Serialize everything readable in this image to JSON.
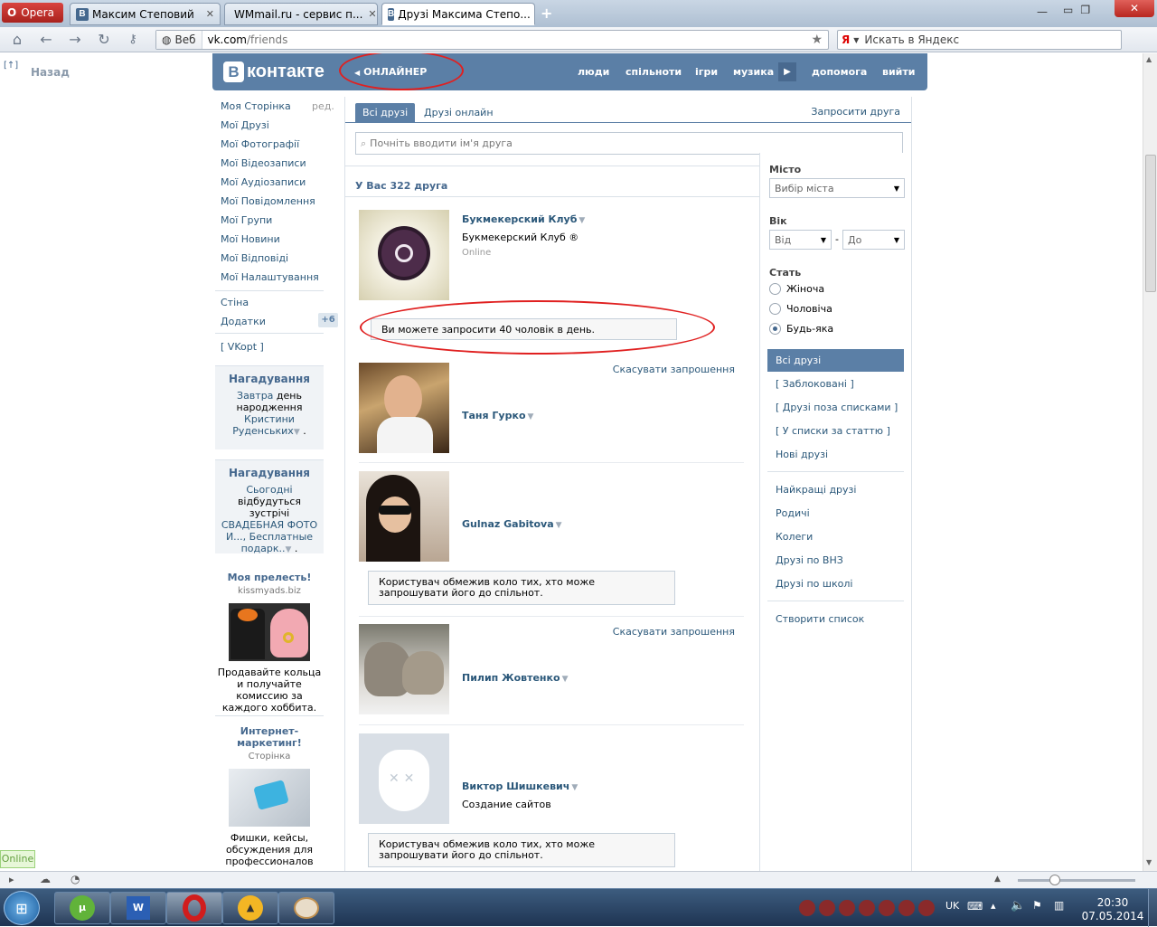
{
  "browser": {
    "opera_label": "Opera",
    "tabs": [
      {
        "title": "Максим Степовий"
      },
      {
        "title": "WMmail.ru - сервис п..."
      },
      {
        "title": "Друзі Максима Степо..."
      }
    ],
    "web_label": "Веб",
    "url_host": "vk.com",
    "url_path": "/friends",
    "search_placeholder": "Искать в Яндекс"
  },
  "page": {
    "back_label": "Назад",
    "header": {
      "logo_text": "контакте",
      "onliner": "ОНЛАЙНЕР",
      "nav": [
        "люди",
        "спільноти",
        "ігри",
        "музика",
        "допомога",
        "вийти"
      ]
    },
    "left_menu": {
      "items": [
        "Моя Сторінка",
        "Мої Друзі",
        "Мої Фотографії",
        "Мої Відеозаписи",
        "Мої Аудіозаписи",
        "Мої Повідомлення",
        "Мої Групи",
        "Мої Новини",
        "Мої Відповіді",
        "Мої Налаштування"
      ],
      "edit_label": "ред.",
      "wall": "Стіна",
      "apps": "Додатки",
      "apps_badge": "+6",
      "vkopt": "[ VKopt ]"
    },
    "reminders": [
      {
        "title": "Нагадування",
        "link1": "Завтра",
        "text1": " день народження",
        "link2": "Кристини Руденських",
        "tail": " ."
      },
      {
        "title": "Нагадування",
        "link1": "Сьогодні",
        "text1": " відбудуться зустрічі",
        "link2": "СВАДЕБНАЯ ФОТО И..., Бесплатные подарк..",
        "tail": " ."
      }
    ],
    "ads": [
      {
        "title": "Моя прелесть!",
        "site": "kissmyads.biz",
        "text": "Продавайте кольца и получайте комиссию за каждого хоббита."
      },
      {
        "title": "Интернет-маркетинг!",
        "site": "Сторінка",
        "text": "Фишки, кейсы, обсуждения для профессионалов"
      }
    ],
    "tabs": {
      "all": "Всі друзі",
      "online": "Друзі онлайн",
      "invite": "Запросити друга"
    },
    "search_placeholder": "Почніть вводити ім'я друга",
    "count_text": "У Вас 322 друга",
    "friends": [
      {
        "name": "Букмекерский Клуб",
        "subtitle": "Букмекерский Клуб ®",
        "status": "Online",
        "action": "",
        "notice": "Ви можете запросити 40 чоловік в день."
      },
      {
        "name": "Таня Гурко",
        "subtitle": "",
        "status": "",
        "action": "Скасувати запрошення",
        "notice": ""
      },
      {
        "name": "Gulnaz Gabitova",
        "subtitle": "",
        "status": "",
        "action": "",
        "notice": "Користувач обмежив коло тих, хто може запрошувати його до спільнот."
      },
      {
        "name": "Пилип Жовтенко",
        "subtitle": "",
        "status": "",
        "action": "Скасувати запрошення",
        "notice": ""
      },
      {
        "name": "Виктор Шишкевич",
        "subtitle": "Создание сайтов",
        "status": "",
        "action": "",
        "notice": "Користувач обмежив коло тих, хто може запрошувати його до спільнот."
      }
    ],
    "filters": {
      "city_label": "Місто",
      "city_value": "Вибір міста",
      "age_label": "Вік",
      "age_from": "Від",
      "age_dash": "-",
      "age_to": "До",
      "sex_label": "Стать",
      "sex_options": [
        "Жіноча",
        "Чоловіча",
        "Будь-яка"
      ],
      "sex_selected": "Будь-яка",
      "lists_a": [
        "Всі друзі",
        "[ Заблоковані ]",
        "[ Друзі поза списками ]",
        "[ У списки за статтю ]",
        "Нові друзі"
      ],
      "lists_b": [
        "Найкращі друзі",
        "Родичі",
        "Колеги",
        "Друзі по ВНЗ",
        "Друзі по школі"
      ],
      "create_list": "Створити список"
    }
  },
  "status": {
    "online_badge": "Online"
  },
  "taskbar": {
    "lang": "UK",
    "time": "20:30",
    "date": "07.05.2014"
  },
  "colors": {
    "vk_blue": "#5b7fa6",
    "link": "#2b587a",
    "annotation": "#e02020"
  }
}
